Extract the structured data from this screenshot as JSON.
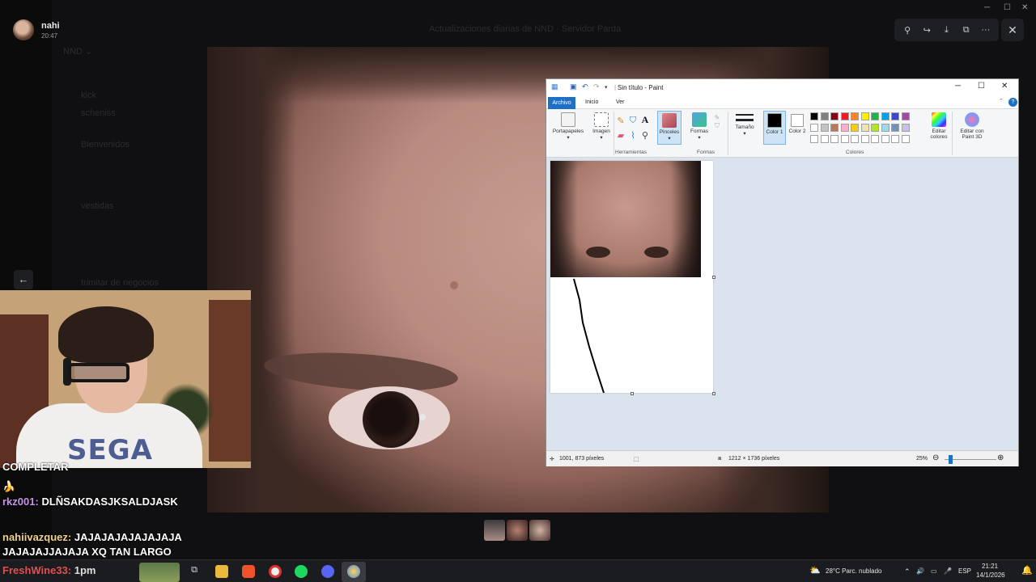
{
  "viewer": {
    "username": "nahi",
    "time": "20:47",
    "tools": [
      "⚲",
      "↪",
      "⤓",
      "⧉",
      "···"
    ],
    "close": "✕"
  },
  "paint": {
    "title": "Sin título - Paint",
    "tabs": {
      "archivo": "Archivo",
      "inicio": "Inicio",
      "ver": "Ver"
    },
    "ribbon": {
      "portapapeles": "Portapapeles",
      "imagen": "Imagen",
      "pinceles": "Pinceles",
      "formas": "Formas",
      "tamano": "Tamaño",
      "color1": "Color 1",
      "color2": "Color 2",
      "editar_colores": "Editar colores",
      "editar_paint3d": "Editar con Paint 3D",
      "grp_herramientas": "Herramientas",
      "grp_formas": "Formas",
      "grp_colores": "Colores"
    },
    "palette_row1": [
      "#000000",
      "#7f7f7f",
      "#880015",
      "#ed1c24",
      "#ff7f27",
      "#fff200",
      "#22b14c",
      "#00a2e8",
      "#3f48cc",
      "#a349a4"
    ],
    "palette_row2": [
      "#ffffff",
      "#c3c3c3",
      "#b97a57",
      "#ffaec9",
      "#ffc90e",
      "#efe4b0",
      "#b5e61d",
      "#99d9ea",
      "#7092be",
      "#c8bfe7"
    ],
    "status": {
      "cursor": "1001, 873 píxeles",
      "size": "1212 × 1736 píxeles",
      "zoom": "25%"
    }
  },
  "chat": {
    "line0": "COMPLETAR",
    "line1": "🍌",
    "user2": "rkz001:",
    "msg2": "DLÑSAKDASJKSALDJASK",
    "user3": "nahiivazquez:",
    "msg3": "JAJAJAJAJAJAJAJA",
    "msg3b": "JAJAJAJJAJAJA XQ TAN LARGO",
    "user4": "FreshWine33:",
    "msg4": "1pm"
  },
  "taskbar": {
    "weather": "28°C  Parc. nublado",
    "lang": "ESP",
    "clock_time": "21:21",
    "clock_date": "14/1/2026"
  }
}
